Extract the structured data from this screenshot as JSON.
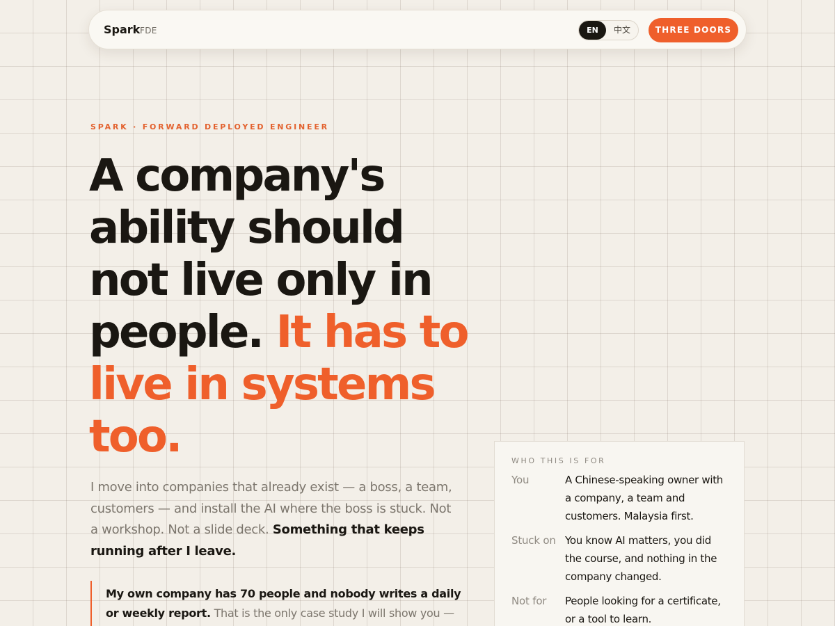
{
  "nav": {
    "brand": "Spark",
    "brand_sub": "FDE",
    "lang_en": "EN",
    "lang_zh": "中文",
    "cta": "THREE DOORS"
  },
  "hero": {
    "eyebrow": "SPARK · FORWARD DEPLOYED ENGINEER",
    "headline_plain": "A company's ability should not live only in people.",
    "headline_accent": "It has to live in systems too.",
    "lede_plain": "I move into companies that already exist — a boss, a team, customers — and install the AI where the boss is stuck. Not a workshop. Not a slide deck.",
    "lede_bold": "Something that keeps running after I leave.",
    "quote_bold": "My own company has 70 people and nobody writes a daily or weekly report.",
    "quote_plain": "That is the only case study I will show you — walk in"
  },
  "card": {
    "title": "WHO THIS IS FOR",
    "rows": [
      {
        "label": "You",
        "text": "A Chinese-speaking owner with a company, a team and customers. Malaysia first."
      },
      {
        "label": "Stuck on",
        "text": "You know AI matters, you did the course, and nothing in the company changed."
      },
      {
        "label": "Not for",
        "text": "People looking for a certificate, or a tool to learn."
      }
    ]
  },
  "colors": {
    "accent": "#ef5f2b",
    "ink": "#1a1712",
    "paper": "#f3efe8",
    "muted": "#7c766d"
  }
}
